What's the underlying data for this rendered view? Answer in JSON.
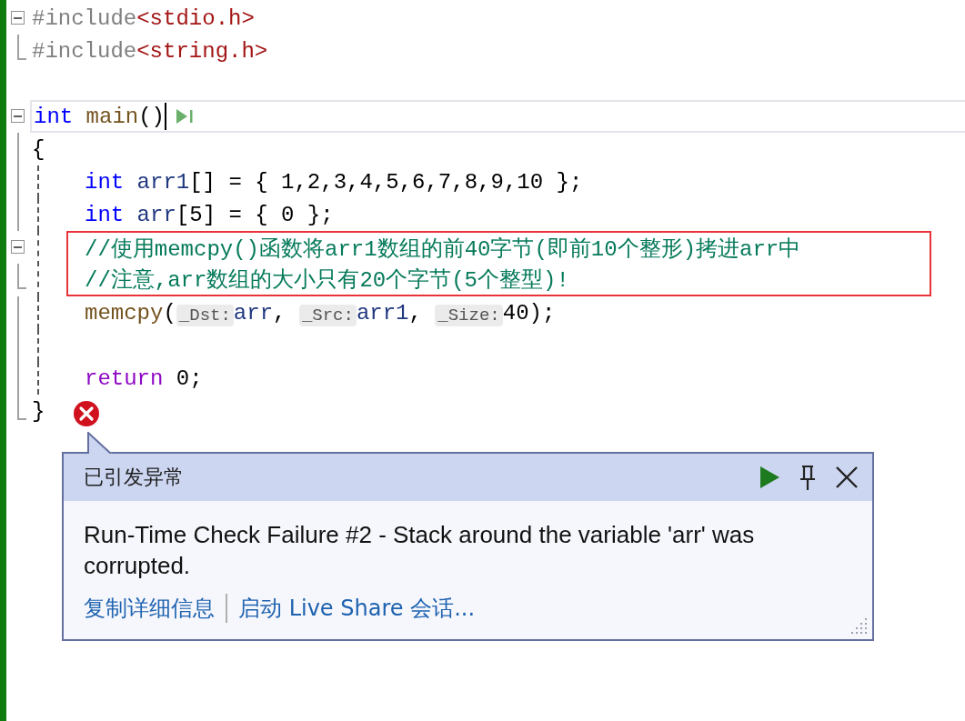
{
  "editor": {
    "lines": [
      {
        "kind": "fold-start",
        "indented": false,
        "current": false,
        "boxed": false,
        "error": false,
        "tokens": [
          {
            "kind": "directive",
            "text": "#include"
          },
          {
            "kind": "string",
            "text": "<stdio.h>"
          }
        ]
      },
      {
        "kind": "fold-end",
        "indented": false,
        "current": false,
        "boxed": false,
        "error": false,
        "tokens": [
          {
            "kind": "directive",
            "text": "#include"
          },
          {
            "kind": "string",
            "text": "<string.h>"
          }
        ]
      },
      {
        "kind": "blank",
        "indented": false,
        "current": false,
        "boxed": false,
        "error": false
      },
      {
        "kind": "fold-start",
        "indented": false,
        "current": true,
        "boxed": false,
        "error": false,
        "tokens": [
          {
            "kind": "keyword",
            "text": "int "
          },
          {
            "kind": "function",
            "text": "main"
          },
          {
            "kind": "plain",
            "text": "()"
          }
        ]
      },
      {
        "kind": "body",
        "indented": false,
        "current": false,
        "boxed": false,
        "error": false,
        "tokens": [
          {
            "kind": "plain",
            "text": "{"
          }
        ]
      },
      {
        "kind": "body",
        "indented": true,
        "current": false,
        "boxed": false,
        "error": false,
        "tokens": [
          {
            "kind": "keyword",
            "text": "int "
          },
          {
            "kind": "variable",
            "text": "arr1"
          },
          {
            "kind": "plain",
            "text": "[] = { 1,2,3,4,5,6,7,8,9,10 };"
          }
        ]
      },
      {
        "kind": "body",
        "indented": true,
        "current": false,
        "boxed": false,
        "error": false,
        "tokens": [
          {
            "kind": "keyword",
            "text": "int "
          },
          {
            "kind": "variable",
            "text": "arr"
          },
          {
            "kind": "plain",
            "text": "[5] = { 0 };"
          }
        ]
      },
      {
        "kind": "fold-start",
        "indented": true,
        "current": false,
        "boxed": true,
        "error": false,
        "tokens": [
          {
            "kind": "comment",
            "text": "//使用memcpy()函数将arr1数组的前40字节(即前10个整形)拷进arr中"
          }
        ]
      },
      {
        "kind": "fold-end",
        "indented": true,
        "current": false,
        "boxed": true,
        "error": false,
        "tokens": [
          {
            "kind": "comment",
            "text": "//注意,arr数组的大小只有20个字节(5个整型)!"
          }
        ]
      },
      {
        "kind": "body",
        "indented": true,
        "current": false,
        "boxed": false,
        "error": false,
        "tokens": [
          {
            "kind": "function",
            "text": "memcpy"
          },
          {
            "kind": "plain",
            "text": "("
          },
          {
            "kind": "hint",
            "text": "_Dst:"
          },
          {
            "kind": "variable",
            "text": "arr"
          },
          {
            "kind": "plain",
            "text": ", "
          },
          {
            "kind": "hint",
            "text": "_Src:"
          },
          {
            "kind": "variable",
            "text": "arr1"
          },
          {
            "kind": "plain",
            "text": ", "
          },
          {
            "kind": "hint",
            "text": "_Size:"
          },
          {
            "kind": "plain",
            "text": "40);"
          }
        ]
      },
      {
        "kind": "body",
        "indented": true,
        "current": false,
        "boxed": false,
        "error": false
      },
      {
        "kind": "body",
        "indented": true,
        "current": false,
        "boxed": false,
        "error": false,
        "tokens": [
          {
            "kind": "control",
            "text": "return"
          },
          {
            "kind": "plain",
            "text": " 0;"
          }
        ]
      },
      {
        "kind": "fold-end",
        "indented": false,
        "current": false,
        "boxed": false,
        "error": true,
        "tokens": [
          {
            "kind": "plain",
            "text": "}"
          }
        ]
      }
    ]
  },
  "exception": {
    "title": "已引发异常",
    "message": "Run-Time Check Failure #2 - Stack around the variable 'arr' was corrupted.",
    "links": [
      "复制详细信息",
      "启动 Live Share 会话..."
    ]
  }
}
